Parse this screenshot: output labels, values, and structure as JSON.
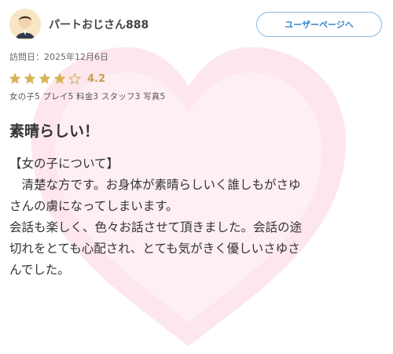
{
  "header": {
    "avatar_icon": "user-avatar-icon",
    "username": "パートおじさん888",
    "user_page_button_label": "ユーザーページへ"
  },
  "visit": {
    "label_and_date": "訪問日：2025年12月6日"
  },
  "rating": {
    "value_text": "4.2",
    "value": 4.2,
    "max": 5,
    "sub_scores": "女の子5 プレイ5 料金3 スタッフ3 写真5"
  },
  "review": {
    "title": "素晴らしい！",
    "lines": [
      "【女の子について】",
      "　清楚な方です。お身体が素晴らしいく誰しもがさゆ",
      "さんの虜になってしまいます。",
      "会話も楽しく、色々お話させて頂きました。会話の途",
      "切れをとても心配され、とても気がきく優しいさゆさ",
      "んでした。"
    ]
  },
  "colors": {
    "star_filled": "#d9b35a",
    "accent_blue": "#3b87c9",
    "watermark_pink": "#fde3ea"
  }
}
